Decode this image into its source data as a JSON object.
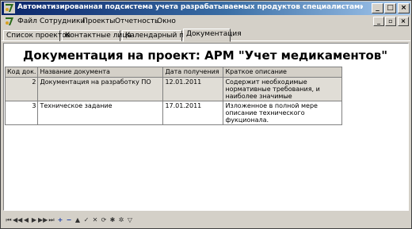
{
  "window": {
    "title": "Автоматизированная подсистема учета разрабатываемых продуктов специалистами ООО \"Система\" - [...",
    "minimize": "_",
    "maximize": "□",
    "close": "×"
  },
  "menu": {
    "items": [
      "Файл",
      "Сотрудники",
      "Проекты",
      "Отчетность",
      "Окно"
    ],
    "mdi_minimize": "_",
    "mdi_restore": "▫",
    "mdi_close": "×"
  },
  "tabs": [
    "Список проектов",
    "Контактные лица",
    "Календарный план",
    "Документация"
  ],
  "active_tab": 3,
  "page": {
    "heading": "Документация на проект: АРМ \"Учет медикаментов\""
  },
  "table": {
    "columns": [
      "Код док.",
      "Название документа",
      "Дата получения",
      "Краткое описание"
    ],
    "rows": [
      [
        "2",
        "Документация на разработку ПО",
        "12.01.2011",
        "Содержит необходимые нормативные требования, и наиболее значимые"
      ],
      [
        "3",
        "Техническое задание",
        "17.01.2011",
        "Изложенное в полной мере описание технического фукционала."
      ]
    ]
  },
  "navigator": {
    "buttons": [
      {
        "name": "first-icon",
        "glyph": "⏮"
      },
      {
        "name": "prev-page-icon",
        "glyph": "◀◀"
      },
      {
        "name": "prev-icon",
        "glyph": "◀"
      },
      {
        "name": "next-icon",
        "glyph": "▶"
      },
      {
        "name": "next-page-icon",
        "glyph": "▶▶"
      },
      {
        "name": "last-icon",
        "glyph": "⏭"
      },
      {
        "name": "insert-icon",
        "glyph": "+"
      },
      {
        "name": "delete-icon",
        "glyph": "−"
      },
      {
        "name": "edit-icon",
        "glyph": "▲"
      },
      {
        "name": "post-icon",
        "glyph": "✓"
      },
      {
        "name": "cancel-icon",
        "glyph": "✕"
      },
      {
        "name": "refresh-icon",
        "glyph": "⟳"
      },
      {
        "name": "apply-updates-icon",
        "glyph": "✱"
      },
      {
        "name": "cancel-updates-icon",
        "glyph": "✲"
      },
      {
        "name": "filter-icon",
        "glyph": "▽"
      }
    ]
  },
  "colors": {
    "title_gradient_start": "#0a246a",
    "title_gradient_end": "#a6caf0",
    "window_face": "#d4d0c8",
    "nav_accent": "#1c3fa8"
  }
}
